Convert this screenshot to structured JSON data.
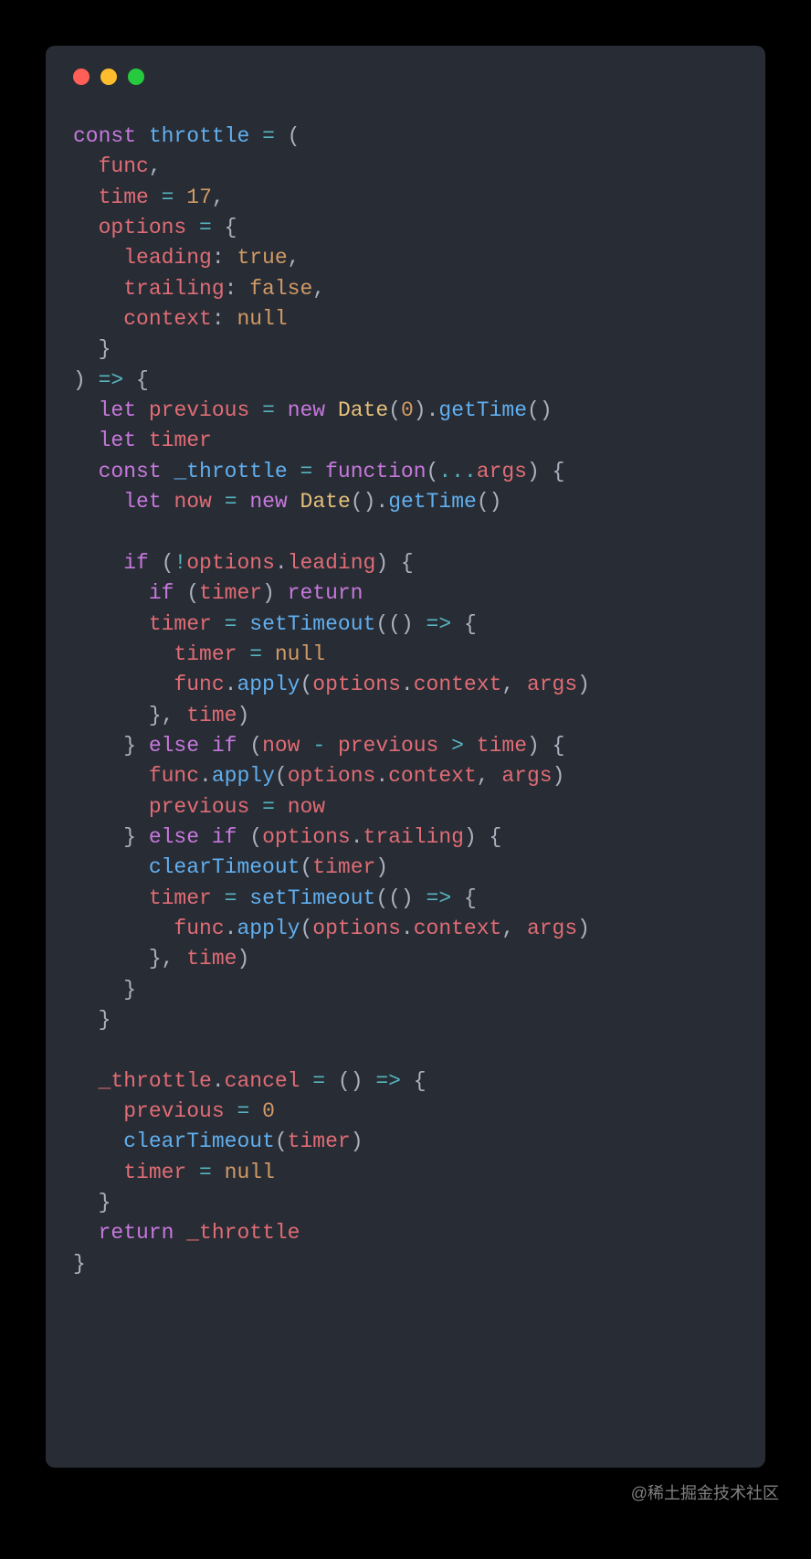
{
  "watermark": "@稀土掘金技术社区",
  "traffic_lights": [
    "red",
    "yellow",
    "green"
  ],
  "code": {
    "language": "javascript",
    "tokens": [
      [
        [
          "kw",
          "const"
        ],
        [
          "pun",
          " "
        ],
        [
          "fn",
          "throttle"
        ],
        [
          "pun",
          " "
        ],
        [
          "op",
          "="
        ],
        [
          "pun",
          " ("
        ]
      ],
      [
        [
          "pun",
          "  "
        ],
        [
          "id",
          "func"
        ],
        [
          "pun",
          ","
        ]
      ],
      [
        [
          "pun",
          "  "
        ],
        [
          "id",
          "time"
        ],
        [
          "pun",
          " "
        ],
        [
          "op",
          "="
        ],
        [
          "pun",
          " "
        ],
        [
          "num",
          "17"
        ],
        [
          "pun",
          ","
        ]
      ],
      [
        [
          "pun",
          "  "
        ],
        [
          "id",
          "options"
        ],
        [
          "pun",
          " "
        ],
        [
          "op",
          "="
        ],
        [
          "pun",
          " {"
        ]
      ],
      [
        [
          "pun",
          "    "
        ],
        [
          "prop",
          "leading"
        ],
        [
          "pun",
          ": "
        ],
        [
          "bool",
          "true"
        ],
        [
          "pun",
          ","
        ]
      ],
      [
        [
          "pun",
          "    "
        ],
        [
          "prop",
          "trailing"
        ],
        [
          "pun",
          ": "
        ],
        [
          "bool",
          "false"
        ],
        [
          "pun",
          ","
        ]
      ],
      [
        [
          "pun",
          "    "
        ],
        [
          "prop",
          "context"
        ],
        [
          "pun",
          ": "
        ],
        [
          "bool",
          "null"
        ]
      ],
      [
        [
          "pun",
          "  }"
        ]
      ],
      [
        [
          "pun",
          ") "
        ],
        [
          "op",
          "=>"
        ],
        [
          "pun",
          " {"
        ]
      ],
      [
        [
          "pun",
          "  "
        ],
        [
          "kw",
          "let"
        ],
        [
          "pun",
          " "
        ],
        [
          "id",
          "previous"
        ],
        [
          "pun",
          " "
        ],
        [
          "op",
          "="
        ],
        [
          "pun",
          " "
        ],
        [
          "kw",
          "new"
        ],
        [
          "pun",
          " "
        ],
        [
          "cls",
          "Date"
        ],
        [
          "pun",
          "("
        ],
        [
          "num",
          "0"
        ],
        [
          "pun",
          ")."
        ],
        [
          "fn",
          "getTime"
        ],
        [
          "pun",
          "()"
        ]
      ],
      [
        [
          "pun",
          "  "
        ],
        [
          "kw",
          "let"
        ],
        [
          "pun",
          " "
        ],
        [
          "id",
          "timer"
        ]
      ],
      [
        [
          "pun",
          "  "
        ],
        [
          "kw",
          "const"
        ],
        [
          "pun",
          " "
        ],
        [
          "fn",
          "_throttle"
        ],
        [
          "pun",
          " "
        ],
        [
          "op",
          "="
        ],
        [
          "pun",
          " "
        ],
        [
          "kw",
          "function"
        ],
        [
          "pun",
          "("
        ],
        [
          "op",
          "..."
        ],
        [
          "id",
          "args"
        ],
        [
          "pun",
          ") {"
        ]
      ],
      [
        [
          "pun",
          "    "
        ],
        [
          "kw",
          "let"
        ],
        [
          "pun",
          " "
        ],
        [
          "id",
          "now"
        ],
        [
          "pun",
          " "
        ],
        [
          "op",
          "="
        ],
        [
          "pun",
          " "
        ],
        [
          "kw",
          "new"
        ],
        [
          "pun",
          " "
        ],
        [
          "cls",
          "Date"
        ],
        [
          "pun",
          "()."
        ],
        [
          "fn",
          "getTime"
        ],
        [
          "pun",
          "()"
        ]
      ],
      [
        [
          "pun",
          ""
        ]
      ],
      [
        [
          "pun",
          "    "
        ],
        [
          "kw",
          "if"
        ],
        [
          "pun",
          " ("
        ],
        [
          "op",
          "!"
        ],
        [
          "id",
          "options"
        ],
        [
          "pun",
          "."
        ],
        [
          "prop",
          "leading"
        ],
        [
          "pun",
          ") {"
        ]
      ],
      [
        [
          "pun",
          "      "
        ],
        [
          "kw",
          "if"
        ],
        [
          "pun",
          " ("
        ],
        [
          "id",
          "timer"
        ],
        [
          "pun",
          ") "
        ],
        [
          "kw",
          "return"
        ]
      ],
      [
        [
          "pun",
          "      "
        ],
        [
          "id",
          "timer"
        ],
        [
          "pun",
          " "
        ],
        [
          "op",
          "="
        ],
        [
          "pun",
          " "
        ],
        [
          "fn",
          "setTimeout"
        ],
        [
          "pun",
          "(() "
        ],
        [
          "op",
          "=>"
        ],
        [
          "pun",
          " {"
        ]
      ],
      [
        [
          "pun",
          "        "
        ],
        [
          "id",
          "timer"
        ],
        [
          "pun",
          " "
        ],
        [
          "op",
          "="
        ],
        [
          "pun",
          " "
        ],
        [
          "bool",
          "null"
        ]
      ],
      [
        [
          "pun",
          "        "
        ],
        [
          "id",
          "func"
        ],
        [
          "pun",
          "."
        ],
        [
          "fn",
          "apply"
        ],
        [
          "pun",
          "("
        ],
        [
          "id",
          "options"
        ],
        [
          "pun",
          "."
        ],
        [
          "prop",
          "context"
        ],
        [
          "pun",
          ", "
        ],
        [
          "id",
          "args"
        ],
        [
          "pun",
          ")"
        ]
      ],
      [
        [
          "pun",
          "      }, "
        ],
        [
          "id",
          "time"
        ],
        [
          "pun",
          ")"
        ]
      ],
      [
        [
          "pun",
          "    } "
        ],
        [
          "kw",
          "else"
        ],
        [
          "pun",
          " "
        ],
        [
          "kw",
          "if"
        ],
        [
          "pun",
          " ("
        ],
        [
          "id",
          "now"
        ],
        [
          "pun",
          " "
        ],
        [
          "op",
          "-"
        ],
        [
          "pun",
          " "
        ],
        [
          "id",
          "previous"
        ],
        [
          "pun",
          " "
        ],
        [
          "op",
          ">"
        ],
        [
          "pun",
          " "
        ],
        [
          "id",
          "time"
        ],
        [
          "pun",
          ") {"
        ]
      ],
      [
        [
          "pun",
          "      "
        ],
        [
          "id",
          "func"
        ],
        [
          "pun",
          "."
        ],
        [
          "fn",
          "apply"
        ],
        [
          "pun",
          "("
        ],
        [
          "id",
          "options"
        ],
        [
          "pun",
          "."
        ],
        [
          "prop",
          "context"
        ],
        [
          "pun",
          ", "
        ],
        [
          "id",
          "args"
        ],
        [
          "pun",
          ")"
        ]
      ],
      [
        [
          "pun",
          "      "
        ],
        [
          "id",
          "previous"
        ],
        [
          "pun",
          " "
        ],
        [
          "op",
          "="
        ],
        [
          "pun",
          " "
        ],
        [
          "id",
          "now"
        ]
      ],
      [
        [
          "pun",
          "    } "
        ],
        [
          "kw",
          "else"
        ],
        [
          "pun",
          " "
        ],
        [
          "kw",
          "if"
        ],
        [
          "pun",
          " ("
        ],
        [
          "id",
          "options"
        ],
        [
          "pun",
          "."
        ],
        [
          "prop",
          "trailing"
        ],
        [
          "pun",
          ") {"
        ]
      ],
      [
        [
          "pun",
          "      "
        ],
        [
          "fn",
          "clearTimeout"
        ],
        [
          "pun",
          "("
        ],
        [
          "id",
          "timer"
        ],
        [
          "pun",
          ")"
        ]
      ],
      [
        [
          "pun",
          "      "
        ],
        [
          "id",
          "timer"
        ],
        [
          "pun",
          " "
        ],
        [
          "op",
          "="
        ],
        [
          "pun",
          " "
        ],
        [
          "fn",
          "setTimeout"
        ],
        [
          "pun",
          "(() "
        ],
        [
          "op",
          "=>"
        ],
        [
          "pun",
          " {"
        ]
      ],
      [
        [
          "pun",
          "        "
        ],
        [
          "id",
          "func"
        ],
        [
          "pun",
          "."
        ],
        [
          "fn",
          "apply"
        ],
        [
          "pun",
          "("
        ],
        [
          "id",
          "options"
        ],
        [
          "pun",
          "."
        ],
        [
          "prop",
          "context"
        ],
        [
          "pun",
          ", "
        ],
        [
          "id",
          "args"
        ],
        [
          "pun",
          ")"
        ]
      ],
      [
        [
          "pun",
          "      }, "
        ],
        [
          "id",
          "time"
        ],
        [
          "pun",
          ")"
        ]
      ],
      [
        [
          "pun",
          "    }"
        ]
      ],
      [
        [
          "pun",
          "  }"
        ]
      ],
      [
        [
          "pun",
          ""
        ]
      ],
      [
        [
          "pun",
          "  "
        ],
        [
          "id",
          "_throttle"
        ],
        [
          "pun",
          "."
        ],
        [
          "prop",
          "cancel"
        ],
        [
          "pun",
          " "
        ],
        [
          "op",
          "="
        ],
        [
          "pun",
          " () "
        ],
        [
          "op",
          "=>"
        ],
        [
          "pun",
          " {"
        ]
      ],
      [
        [
          "pun",
          "    "
        ],
        [
          "id",
          "previous"
        ],
        [
          "pun",
          " "
        ],
        [
          "op",
          "="
        ],
        [
          "pun",
          " "
        ],
        [
          "num",
          "0"
        ]
      ],
      [
        [
          "pun",
          "    "
        ],
        [
          "fn",
          "clearTimeout"
        ],
        [
          "pun",
          "("
        ],
        [
          "id",
          "timer"
        ],
        [
          "pun",
          ")"
        ]
      ],
      [
        [
          "pun",
          "    "
        ],
        [
          "id",
          "timer"
        ],
        [
          "pun",
          " "
        ],
        [
          "op",
          "="
        ],
        [
          "pun",
          " "
        ],
        [
          "bool",
          "null"
        ]
      ],
      [
        [
          "pun",
          "  }"
        ]
      ],
      [
        [
          "pun",
          "  "
        ],
        [
          "kw",
          "return"
        ],
        [
          "pun",
          " "
        ],
        [
          "id",
          "_throttle"
        ]
      ],
      [
        [
          "pun",
          "}"
        ]
      ]
    ]
  }
}
